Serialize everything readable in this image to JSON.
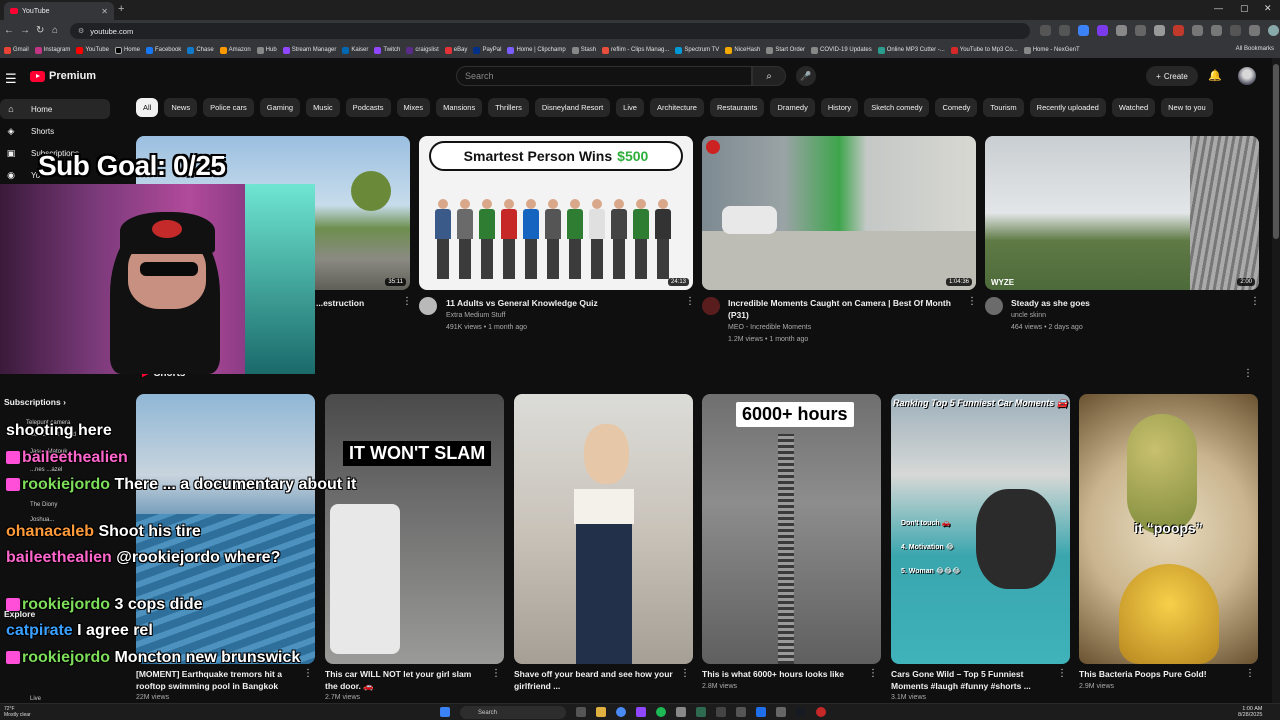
{
  "browser": {
    "tab_title": "YouTube",
    "url": "youtube.com",
    "bookmarks": [
      "Gmail",
      "Instagram",
      "YouTube",
      "Home",
      "Facebook",
      "Chase",
      "Amazon",
      "Hub",
      "Stream Manager",
      "Kaiser",
      "Twitch",
      "craigslist",
      "eBay",
      "PayPal",
      "Home | Clipchamp",
      "Stash",
      "reflim - Clips Manag...",
      "Spectrum TV",
      "NiceHash",
      "Start Order",
      "COVID-19 Updates",
      "Online MP3 Cutter -...",
      "YouTube to Mp3 Co...",
      "Home - NexGenT"
    ],
    "all_bookmarks": "All Bookmarks"
  },
  "header": {
    "logo_text": "Premium",
    "search_placeholder": "Search",
    "create_label": "Create"
  },
  "sidebar": {
    "items": [
      {
        "label": "Home",
        "icon": "home-icon"
      },
      {
        "label": "Shorts",
        "icon": "shorts-icon"
      },
      {
        "label": "Subscriptions",
        "icon": "subscriptions-icon"
      },
      {
        "label": "Yo",
        "icon": "you-icon"
      }
    ],
    "subscriptions_heading": "Subscriptions",
    "subscriptions": [
      "Telepunt camera",
      "BeardMeetsFood",
      "Jason Matouk",
      "...nes ...azel",
      "Tim The Tatman",
      "The Diony",
      "Joshua...",
      "...ikes ...oil"
    ],
    "explore_heading": "Explore",
    "explore": [
      "Shopping",
      "Live"
    ]
  },
  "chips": [
    "All",
    "News",
    "Police cars",
    "Gaming",
    "Music",
    "Podcasts",
    "Mixes",
    "Mansions",
    "Thrillers",
    "Disneyland Resort",
    "Live",
    "Architecture",
    "Restaurants",
    "Dramedy",
    "History",
    "Sketch comedy",
    "Comedy",
    "Tourism",
    "Recently uploaded",
    "Watched",
    "New to you"
  ],
  "videos": [
    {
      "title": "...estruction",
      "channel": "",
      "meta": "",
      "duration": "35:11"
    },
    {
      "title": "11 Adults vs General Knowledge Quiz",
      "channel": "Extra Medium Stuff",
      "meta": "491K views • 1 month ago",
      "duration": "24:13",
      "thumb_text": "Smartest Person Wins",
      "thumb_money": "$500"
    },
    {
      "title": "Incredible Moments Caught on Camera | Best Of Month (P31)",
      "channel": "MEO - Incredible Moments",
      "meta": "1.2M views • 1 month ago",
      "duration": "1:04:36"
    },
    {
      "title": "Steady as she goes",
      "channel": "uncle skinn",
      "meta": "464 views • 2 days ago",
      "duration": "2:00",
      "thumb_text": "WYZE"
    }
  ],
  "shorts_heading": "Shorts",
  "shorts": [
    {
      "title": "[MOMENT] Earthquake tremors hit a rooftop swimming pool in Bangkok",
      "views": "22M views"
    },
    {
      "title": "This car WILL NOT let your girl slam the door. 🚗",
      "views": "2.7M views",
      "overlay": "IT WON'T SLAM"
    },
    {
      "title": "Shave off your beard and see how your girlfriend ...",
      "views": ""
    },
    {
      "title": "This is what 6000+ hours looks like",
      "views": "2.8M views",
      "overlay": "6000+ hours"
    },
    {
      "title": "Cars Gone Wild – Top 5 Funniest Moments #laugh #funny #shorts ...",
      "views": "3.1M views",
      "overlay": "Ranking Top 5 Funniest Car Moments 🚘",
      "list": [
        "Don't touch 🚗",
        "4. Motivation 😂",
        "5. Woman 😂😂😂"
      ]
    },
    {
      "title": "This Bacteria Poops Pure Gold!",
      "views": "2.9M views",
      "overlay": "it “poops”"
    }
  ],
  "stream_overlay": {
    "sub_goal": "Sub Goal: 0/25",
    "chat": [
      {
        "user": "",
        "text": "shooting here"
      },
      {
        "user": "baileethealien",
        "text": ""
      },
      {
        "user": "rookiejordo",
        "text": "There ... a documentary about it"
      },
      {
        "user": "ohanacaleb",
        "text": "Shoot his tire"
      },
      {
        "user": "baileethealien",
        "text": "@rookiejordo where?"
      },
      {
        "user": "rookiejordo",
        "text": "3 cops dide"
      },
      {
        "user": "catpirate",
        "text": "I agree rel"
      },
      {
        "user": "rookiejordo",
        "text": "Moncton new brunswick"
      }
    ]
  },
  "taskbar": {
    "weather_temp": "72°F",
    "weather_desc": "Mostly clear",
    "search_label": "Search",
    "time": "1:00 AM",
    "date": "8/28/2025"
  }
}
